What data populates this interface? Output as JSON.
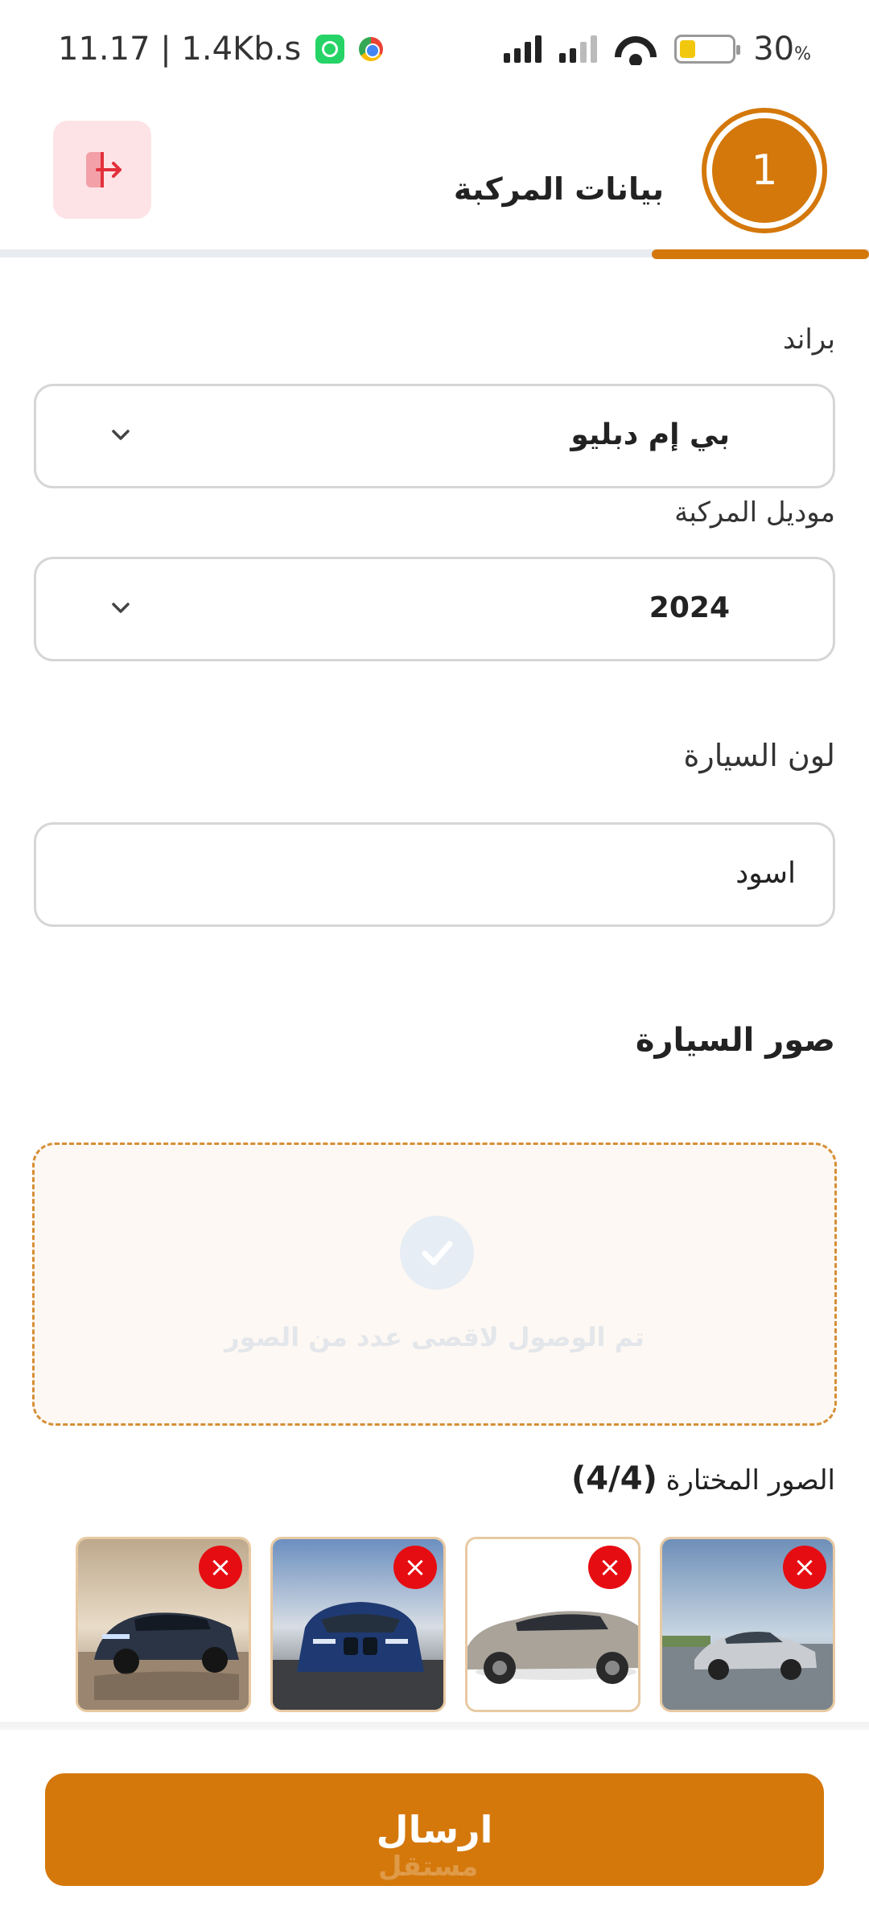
{
  "status_bar": {
    "time_speed": "11.17 | 1.4Kb.s",
    "battery_percent": "30",
    "battery_percent_suffix": "%",
    "battery_level": 0.3
  },
  "header": {
    "step_number": "1",
    "title": "بيانات المركبة",
    "progress": 0.25
  },
  "form": {
    "brand": {
      "label": "براند",
      "value": "بي إم دبليو"
    },
    "model": {
      "label": "موديل المركبة",
      "value": "2024"
    },
    "color": {
      "label": "لون السيارة",
      "value": "اسود"
    }
  },
  "photos": {
    "section_title": "صور السيارة",
    "max_reached_message": "تم الوصول لاقصى عدد من الصور",
    "selected_label": "الصور المختارة",
    "selected_count": "(4/4)",
    "remove_symbol": "×"
  },
  "actions": {
    "submit_label": "ارسال"
  },
  "watermark": "مستقل",
  "colors": {
    "accent": "#d4780b",
    "danger": "#e60d12",
    "exit_bg": "#fde3e6"
  }
}
